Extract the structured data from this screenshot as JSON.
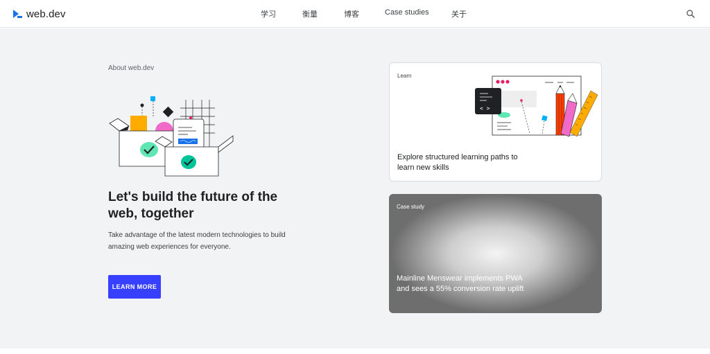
{
  "header": {
    "logo_text": "web.dev",
    "nav": [
      "学习",
      "衡量",
      "博客",
      "Case studies",
      "关于"
    ],
    "icons": {
      "logo": "web-dev-logo-icon",
      "search": "search-icon"
    }
  },
  "hero": {
    "eyebrow": "About web.dev",
    "title": "Let's build the future of the web, together",
    "description": "Take advantage of the latest modern technologies to build amazing web experiences for everyone.",
    "cta_label": "LEARN MORE",
    "illustration": "boxes-illustration"
  },
  "cards": {
    "learn": {
      "tag": "Learn",
      "text": "Explore structured learning paths to learn new skills",
      "illustration": "learning-tools-illustration"
    },
    "case": {
      "tag": "Case study",
      "text": "Mainline Menswear implements PWA and sees a 55% conversion rate uplift"
    }
  },
  "colors": {
    "accent": "#3740ff",
    "background": "#f1f3f4",
    "logo_blue": "#1a73e8",
    "check_green": "#00c49a"
  }
}
